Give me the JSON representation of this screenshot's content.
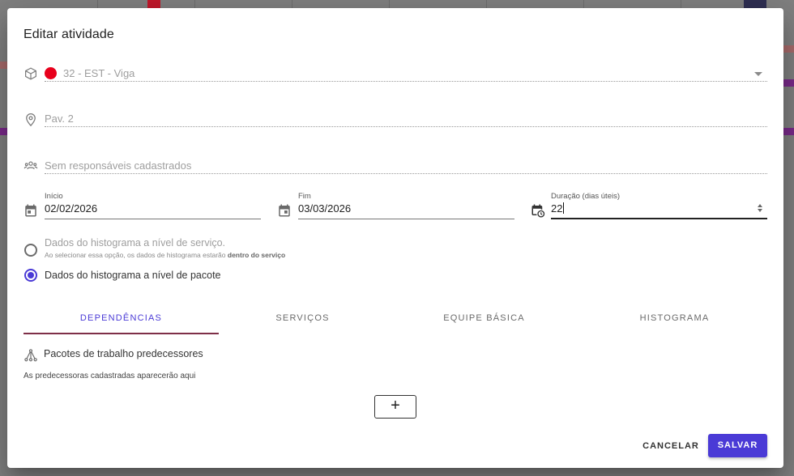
{
  "dialog": {
    "title": "Editar atividade"
  },
  "package_field": {
    "value": "32 - EST - Viga",
    "status_color": "#e8001c",
    "icon": "package-icon"
  },
  "location_field": {
    "placeholder": "Pav. 2",
    "icon": "location-pin-icon"
  },
  "responsibles_field": {
    "placeholder": "Sem responsáveis cadastrados",
    "icon": "people-icon"
  },
  "dates": {
    "start": {
      "label": "Início",
      "value": "02/02/2026",
      "icon": "calendar-icon"
    },
    "end": {
      "label": "Fim",
      "value": "03/03/2026",
      "icon": "calendar-icon"
    },
    "duration": {
      "label": "Duração (dias úteis)",
      "value": "22",
      "icon": "calendar-clock-icon"
    }
  },
  "histogram_options": {
    "service": {
      "label": "Dados do histograma a nível de serviço.",
      "hint_prefix": "Ao selecionar essa opção, os dados de histograma estarão ",
      "hint_bold": "dentro do serviço",
      "selected": false
    },
    "package": {
      "label": "Dados do histograma a nível de pacote",
      "selected": true
    }
  },
  "tabs": [
    {
      "label": "Dependências",
      "active": true
    },
    {
      "label": "Serviços",
      "active": false
    },
    {
      "label": "Equipe básica",
      "active": false
    },
    {
      "label": "Histograma",
      "active": false
    }
  ],
  "dependencies": {
    "title": "Pacotes de trabalho predecessores",
    "empty_text": "As predecessoras cadastradas aparecerão aqui",
    "add_label": "+",
    "icon": "hierarchy-icon"
  },
  "actions": {
    "cancel_label": "CANCELAR",
    "save_label": "SALVAR"
  },
  "colors": {
    "accent": "#4a3ad6",
    "tab_ink": "#7e2f48"
  }
}
